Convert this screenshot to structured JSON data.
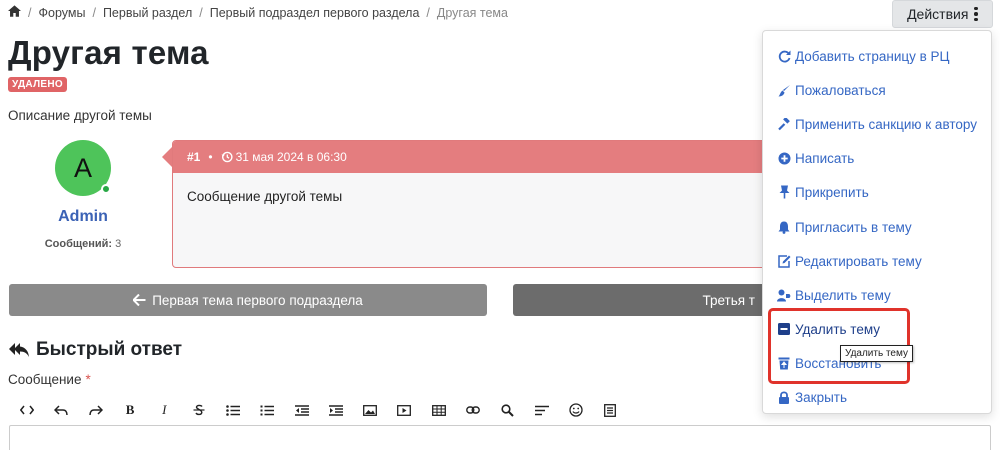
{
  "breadcrumb": {
    "items": [
      "Форумы",
      "Первый раздел",
      "Первый подраздел первого раздела",
      "Другая тема"
    ],
    "separator": "/"
  },
  "actions": {
    "label": "Действия"
  },
  "topic": {
    "title": "Другая тема",
    "badge": "УДАЛЕНО",
    "description": "Описание другой темы"
  },
  "author": {
    "initial": "A",
    "name": "Admin",
    "posts_label": "Сообщений:",
    "posts_count": "3"
  },
  "post": {
    "number": "#1",
    "bullet": "•",
    "date": "31 мая 2024 в 06:30",
    "body": "Сообщение другой темы"
  },
  "nav": {
    "prev_label": "Первая тема первого подраздела",
    "next_label": "Третья т"
  },
  "quick_reply": {
    "title": "Быстрый ответ",
    "message_label": "Сообщение",
    "required_mark": "*"
  },
  "dropdown": {
    "items": [
      {
        "label": "Добавить страницу в РЦ",
        "icon": "refresh-icon"
      },
      {
        "label": "Пожаловаться",
        "icon": "brush-icon"
      },
      {
        "label": "Применить санкцию к автору",
        "icon": "gavel-icon"
      },
      {
        "label": "Написать",
        "icon": "plus-circle-icon"
      },
      {
        "label": "Прикрепить",
        "icon": "pin-icon"
      },
      {
        "label": "Пригласить в тему",
        "icon": "bell-icon"
      },
      {
        "label": "Редактировать тему",
        "icon": "edit-icon"
      },
      {
        "label": "Выделить тему",
        "icon": "user-tag-icon"
      },
      {
        "label": "Удалить тему",
        "icon": "minus-square-icon"
      },
      {
        "label": "Восстановить",
        "icon": "trash-restore-icon"
      },
      {
        "label": "Закрыть",
        "icon": "lock-icon"
      }
    ]
  },
  "tooltip": {
    "text": "Удалить тему"
  },
  "colors": {
    "accent": "#3567c4",
    "danger": "#e47d7f",
    "badge": "#e06466",
    "avatar": "#4ec45a",
    "highlight": "#e0332b"
  }
}
